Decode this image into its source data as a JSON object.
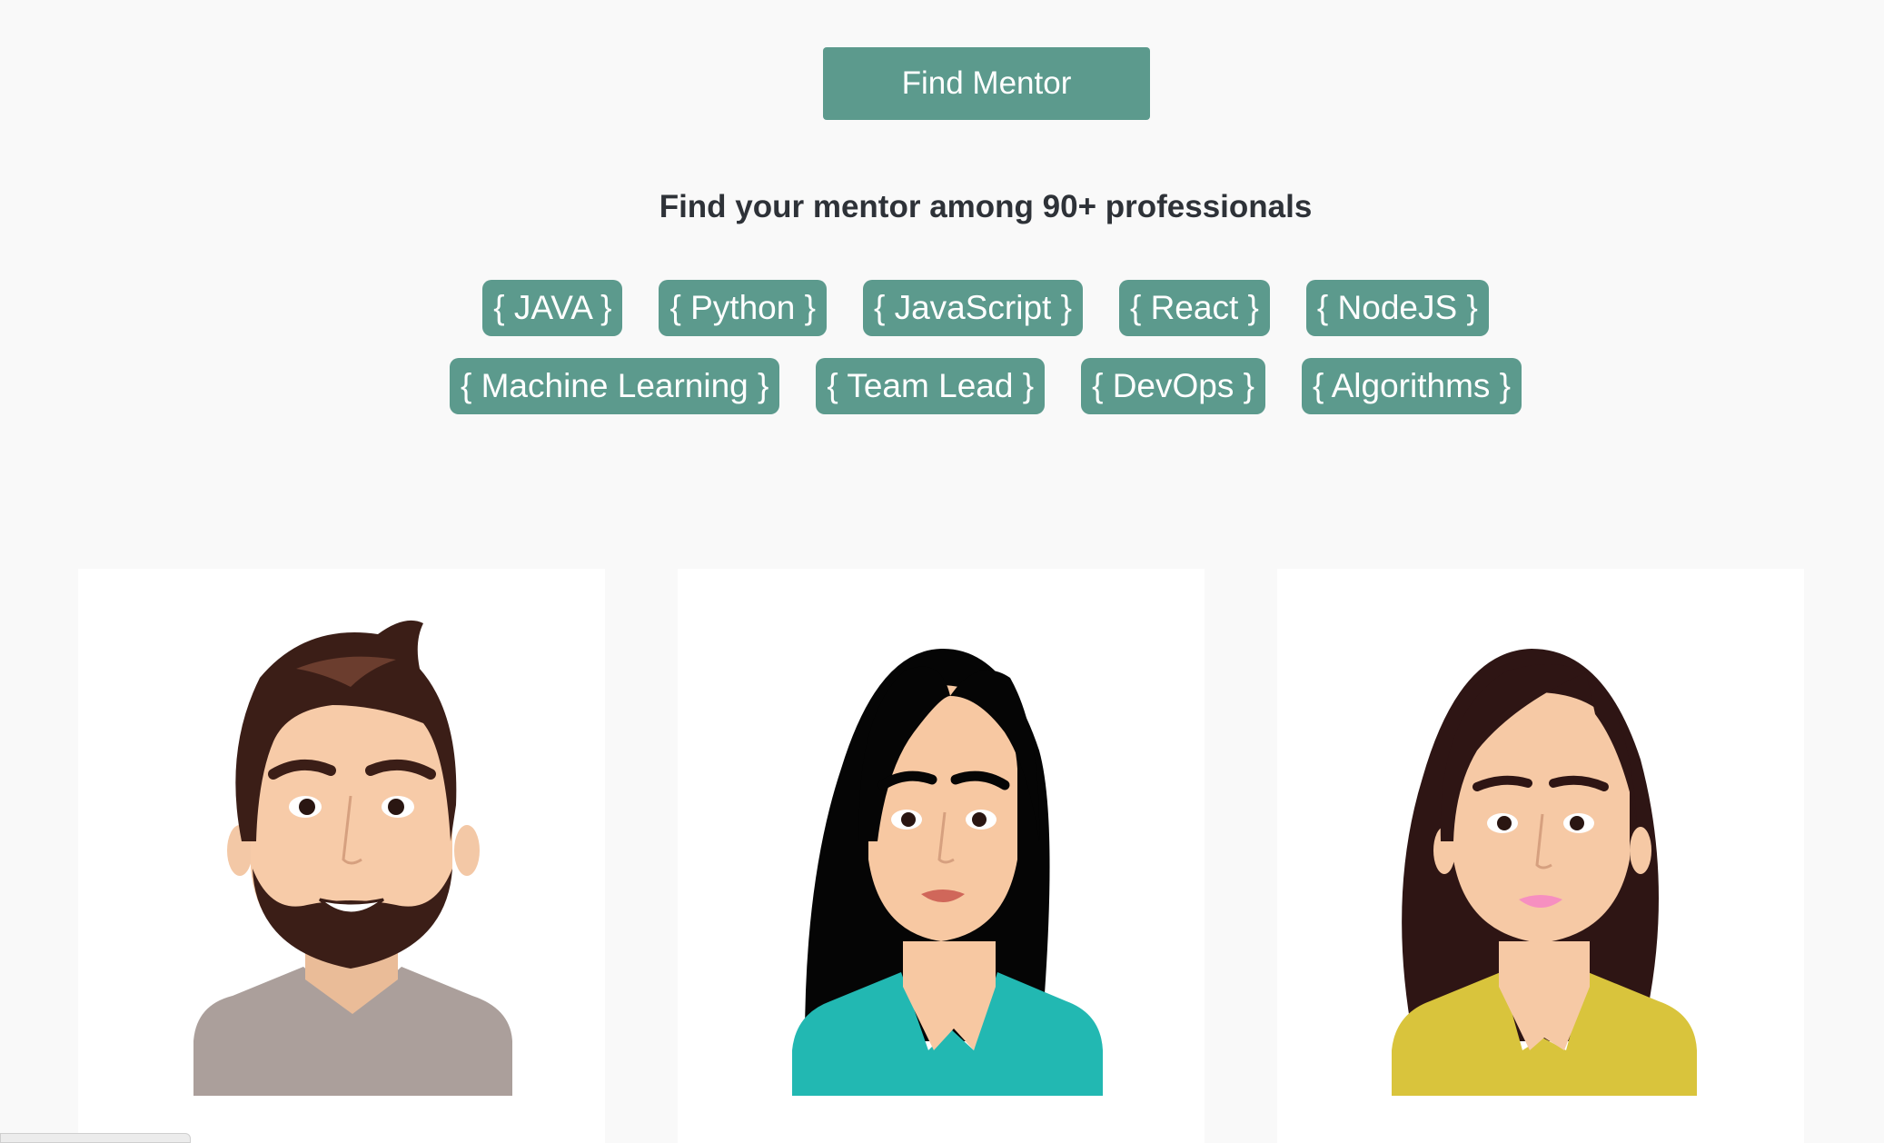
{
  "cta": {
    "find_mentor_label": "Find Mentor"
  },
  "heading": {
    "subtitle": "Find your mentor among 90+ professionals"
  },
  "tags": {
    "row1": [
      "{ JAVA }",
      "{ Python }",
      "{ JavaScript }",
      "{ React }",
      "{ NodeJS }"
    ],
    "row2": [
      "{ Machine Learning }",
      "{ Team Lead }",
      "{ DevOps }",
      "{ Algorithms }"
    ]
  },
  "mentors": [
    {
      "avatar": "bearded-man-avatar",
      "shirt_color": "#ab9f9b"
    },
    {
      "avatar": "black-haired-woman-avatar",
      "shirt_color": "#22b8b2"
    },
    {
      "avatar": "brown-haired-woman-avatar",
      "shirt_color": "#d9c43c"
    }
  ],
  "colors": {
    "accent": "#5c9a8d",
    "background": "#f9f9f9",
    "text": "#2e3238"
  }
}
